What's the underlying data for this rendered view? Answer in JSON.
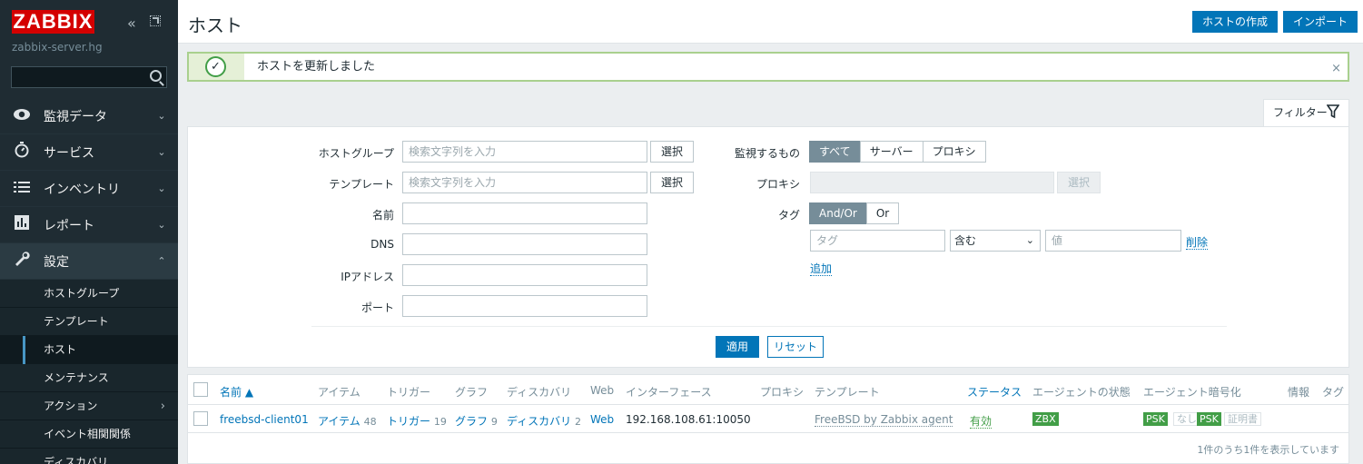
{
  "sidebar": {
    "logo": "ZABBIX",
    "server_name": "zabbix-server.hg",
    "menu": [
      {
        "label": "監視データ",
        "chevron": "⌄"
      },
      {
        "label": "サービス",
        "chevron": "⌄"
      },
      {
        "label": "インベントリ",
        "chevron": "⌄"
      },
      {
        "label": "レポート",
        "chevron": "⌄"
      },
      {
        "label": "設定",
        "chevron": "⌃"
      }
    ],
    "submenu": [
      {
        "label": "ホストグループ"
      },
      {
        "label": "テンプレート"
      },
      {
        "label": "ホスト"
      },
      {
        "label": "メンテナンス"
      },
      {
        "label": "アクション",
        "chevron": "›"
      },
      {
        "label": "イベント相関関係"
      },
      {
        "label": "ディスカバリ"
      }
    ]
  },
  "header": {
    "title": "ホスト",
    "create_button": "ホストの作成",
    "import_button": "インポート"
  },
  "message": {
    "text": "ホストを更新しました",
    "close": "×",
    "check": "✓"
  },
  "filter": {
    "tab_label": "フィルター",
    "host_group_label": "ホストグループ",
    "host_group_placeholder": "検索文字列を入力",
    "template_label": "テンプレート",
    "template_placeholder": "検索文字列を入力",
    "select_button": "選択",
    "name_label": "名前",
    "dns_label": "DNS",
    "ip_label": "IPアドレス",
    "port_label": "ポート",
    "monitored_by_label": "監視するもの",
    "monitored_by_options": [
      "すべて",
      "サーバー",
      "プロキシ"
    ],
    "proxy_label": "プロキシ",
    "tag_label": "タグ",
    "tag_operator_options": [
      "And/Or",
      "Or"
    ],
    "tag_placeholder": "タグ",
    "tag_condition": "含む",
    "value_placeholder": "値",
    "remove_link": "削除",
    "add_link": "追加",
    "apply_button": "適用",
    "reset_button": "リセット"
  },
  "table": {
    "columns": {
      "name": "名前 ▲",
      "items": "アイテム",
      "triggers": "トリガー",
      "graphs": "グラフ",
      "discovery": "ディスカバリ",
      "web": "Web",
      "interface": "インターフェース",
      "proxy": "プロキシ",
      "templates": "テンプレート",
      "status": "ステータス",
      "agent_status": "エージェントの状態",
      "agent_encryption": "エージェント暗号化",
      "info": "情報",
      "tags": "タグ"
    },
    "rows": [
      {
        "name": "freebsd-client01",
        "items_label": "アイテム",
        "items_count": "48",
        "triggers_label": "トリガー",
        "triggers_count": "19",
        "graphs_label": "グラフ",
        "graphs_count": "9",
        "discovery_label": "ディスカバリ",
        "discovery_count": "2",
        "web": "Web",
        "interface": "192.168.108.61:10050",
        "template": "FreeBSD by Zabbix agent",
        "status": "有効",
        "agent_badge": "ZBX",
        "enc_psk1": "PSK",
        "enc_none": "なし",
        "enc_psk2": "PSK",
        "enc_cert": "証明書"
      }
    ],
    "footer": "1件のうち1件を表示しています"
  }
}
